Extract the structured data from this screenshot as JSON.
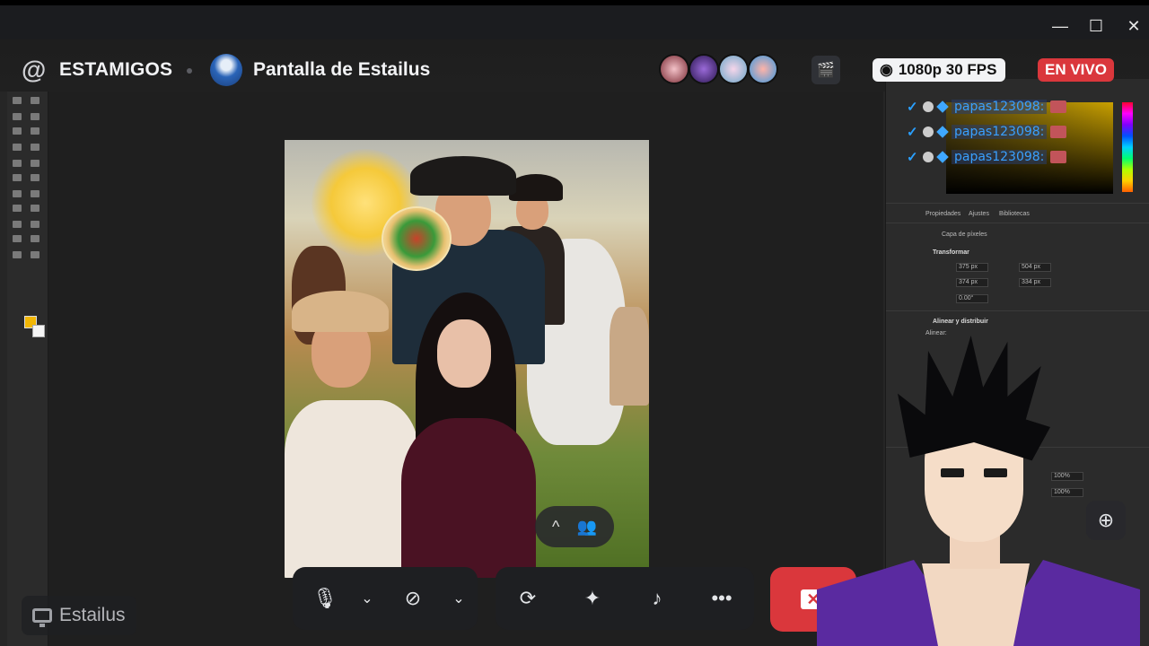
{
  "window": {
    "controls": {
      "minimize": "—",
      "maximize": "☐",
      "close": "✕"
    }
  },
  "header": {
    "channel_icon": "at-icon",
    "channel_name": "ESTAMIGOS",
    "stream_title": "Pantalla de Estailus",
    "quality_label": "1080p 30 FPS",
    "live_label": "EN VIVO",
    "viewers_count_shown": 4,
    "colors": {
      "live": "#da373c",
      "quality_bg": "#f2f3f5"
    }
  },
  "overlay_chat": {
    "lines": [
      {
        "name": "papas123098:"
      },
      {
        "name": "papas123098:"
      },
      {
        "name": "papas123098:"
      }
    ]
  },
  "photoshop": {
    "panel_tabs": [
      "Propiedades",
      "Ajustes",
      "Bibliotecas"
    ],
    "layer_label": "Capa de píxeles",
    "transform_label": "Transformar",
    "width": "375 px",
    "height": "374 px",
    "x": "504 px",
    "y": "334 px",
    "angle": "0.00°",
    "align_label": "Alinear y distribuir",
    "align_sub": "Alinear:",
    "zoom1": "100%",
    "zoom2": "100%"
  },
  "controls": {
    "mic_icon": "microphone-icon",
    "camera_icon": "camera-off-icon",
    "share_icon": "screen-share-icon",
    "activities_icon": "activities-icon",
    "soundboard_icon": "soundboard-icon",
    "more_label": "•••",
    "caret": "⌄",
    "expand_caret": "^",
    "hangup_icon": "disconnect-screen-icon"
  },
  "self": {
    "name": "Estailus"
  }
}
